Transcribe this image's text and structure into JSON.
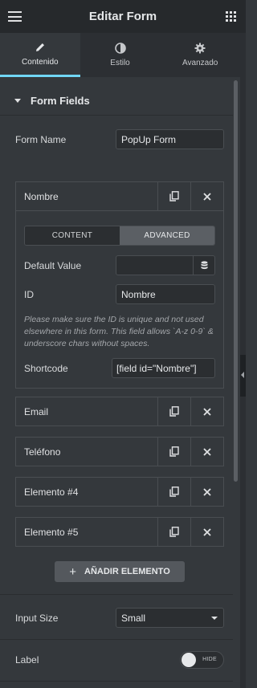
{
  "header": {
    "title": "Editar Form"
  },
  "tabs": [
    {
      "label": "Contenido",
      "icon": "pencil-icon",
      "active": true
    },
    {
      "label": "Estilo",
      "icon": "contrast-icon",
      "active": false
    },
    {
      "label": "Avanzado",
      "icon": "gear-icon",
      "active": false
    }
  ],
  "section": {
    "title": "Form Fields"
  },
  "form_name": {
    "label": "Form Name",
    "value": "PopUp Form"
  },
  "fields": [
    {
      "name": "Nombre",
      "expanded": true
    },
    {
      "name": "Email"
    },
    {
      "name": "Teléfono"
    },
    {
      "name": "Elemento #4"
    },
    {
      "name": "Elemento #5"
    }
  ],
  "field_editor": {
    "tab_content": "CONTENT",
    "tab_advanced": "ADVANCED",
    "active_tab": "ADVANCED",
    "default_value_label": "Default Value",
    "default_value": "",
    "id_label": "ID",
    "id_value": "Nombre",
    "note": "Please make sure the ID is unique and not used elsewhere in this form. This field allows `A-z 0-9` & underscore chars without spaces.",
    "shortcode_label": "Shortcode",
    "shortcode_value": "[field id=\"Nombre\"]"
  },
  "add_button": {
    "label": "AÑADIR ELEMENTO"
  },
  "input_size": {
    "label": "Input Size",
    "value": "Small"
  },
  "label_toggle": {
    "label": "Label",
    "state_text": "HIDE"
  },
  "colors": {
    "accent": "#71d7f7",
    "panel": "#34383c",
    "header": "#26292c"
  }
}
